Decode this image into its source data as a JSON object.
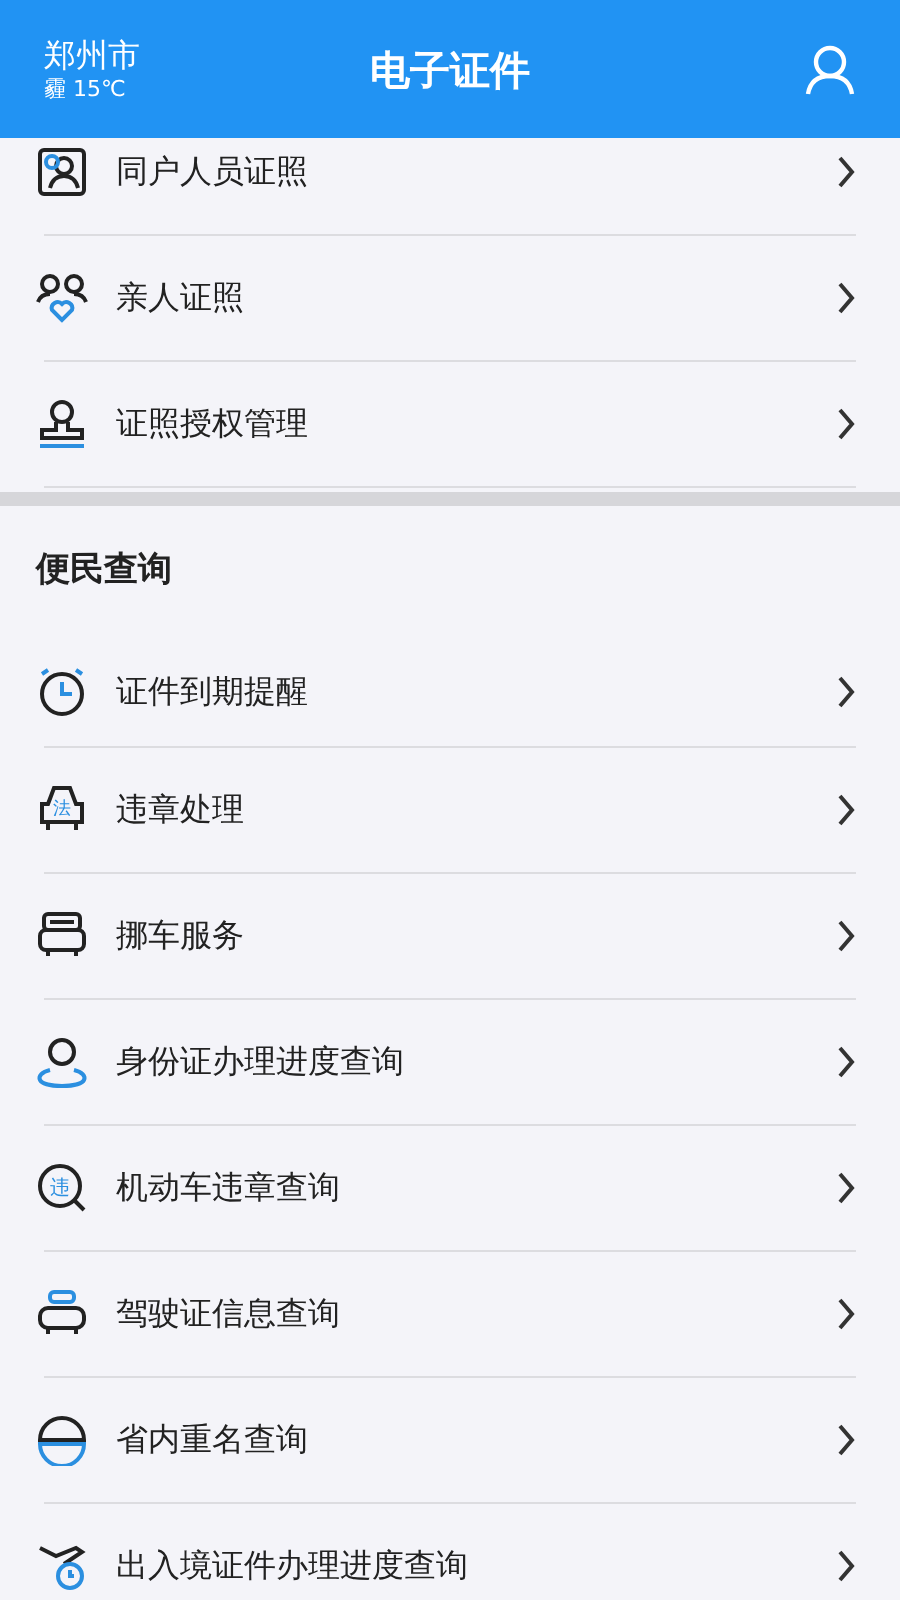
{
  "header": {
    "city": "郑州市",
    "weather": "霾 15℃",
    "title": "电子证件"
  },
  "top_items": [
    {
      "label": "同户人员证照",
      "kind": "person-card"
    },
    {
      "label": "亲人证照",
      "kind": "family"
    },
    {
      "label": "证照授权管理",
      "kind": "stamp"
    }
  ],
  "section": {
    "title": "便民查询",
    "items": [
      {
        "label": "证件到期提醒",
        "kind": "alarm"
      },
      {
        "label": "违章处理",
        "kind": "car-badge",
        "icon_text": "法"
      },
      {
        "label": "挪车服务",
        "kind": "car-front"
      },
      {
        "label": "身份证办理进度查询",
        "kind": "person-pin"
      },
      {
        "label": "机动车违章查询",
        "kind": "search-badge",
        "icon_text": "违"
      },
      {
        "label": "驾驶证信息查询",
        "kind": "car-seat"
      },
      {
        "label": "省内重名查询",
        "kind": "half-circle"
      },
      {
        "label": "出入境证件办理进度查询",
        "kind": "plane-clock"
      }
    ]
  }
}
